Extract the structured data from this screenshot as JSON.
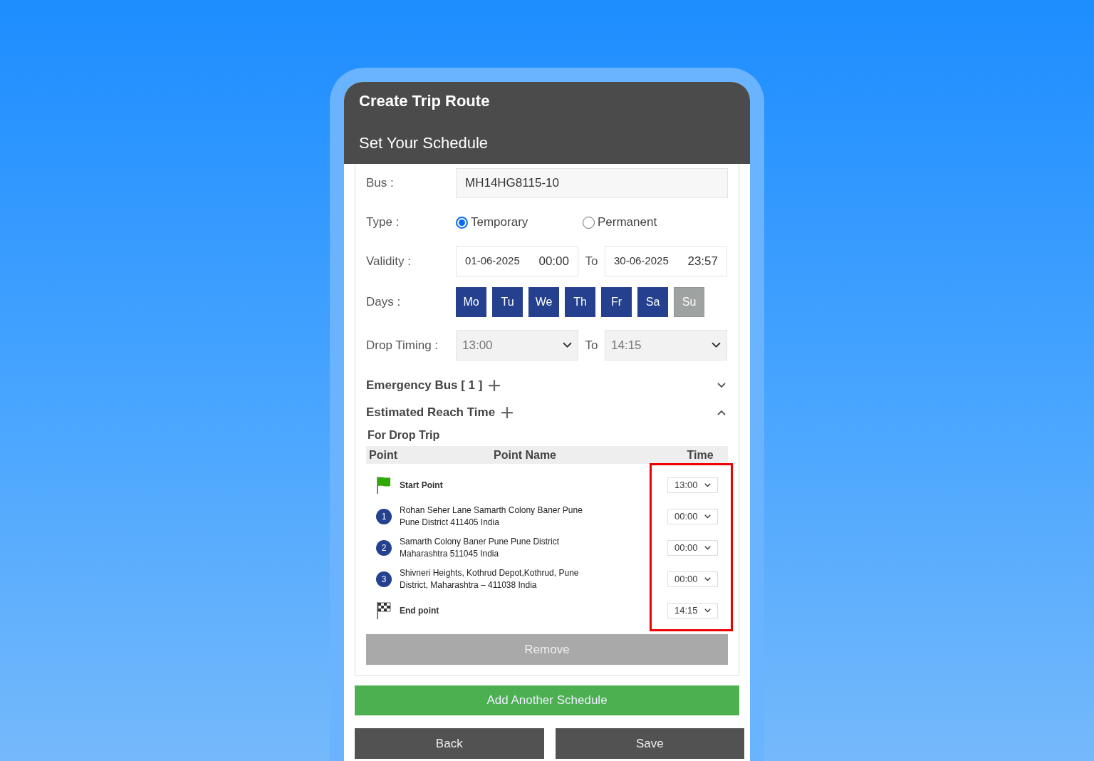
{
  "header": {
    "title": "Create Trip Route",
    "subtitle": "Set Your Schedule"
  },
  "form": {
    "bus": {
      "label": "Bus :",
      "value": "MH14HG8115-10"
    },
    "type": {
      "label": "Type :",
      "options": [
        {
          "label": "Temporary",
          "selected": true
        },
        {
          "label": "Permanent",
          "selected": false
        }
      ]
    },
    "validity": {
      "label": "Validity :",
      "from_date": "01-06-2025",
      "from_time": "00:00",
      "to_label": "To",
      "to_date": "30-06-2025",
      "to_time": "23:57"
    },
    "days": {
      "label": "Days :",
      "items": [
        {
          "label": "Mo",
          "selected": true
        },
        {
          "label": "Tu",
          "selected": true
        },
        {
          "label": "We",
          "selected": true
        },
        {
          "label": "Th",
          "selected": true
        },
        {
          "label": "Fr",
          "selected": true
        },
        {
          "label": "Sa",
          "selected": true
        },
        {
          "label": "Su",
          "selected": false
        }
      ]
    },
    "drop_timing": {
      "label": "Drop Timing :",
      "from": "13:00",
      "to_label": "To",
      "to": "14:15"
    }
  },
  "sections": [
    {
      "title": "Emergency Bus [ 1 ]",
      "expanded": false
    },
    {
      "title": "Estimated Reach Time",
      "expanded": true
    }
  ],
  "reach_table": {
    "title": "For Drop Trip",
    "columns": [
      "Point",
      "Point Name",
      "Time"
    ],
    "rows": [
      {
        "kind": "start",
        "name": "Start Point",
        "time": "13:00"
      },
      {
        "kind": "stop",
        "number": "1",
        "name": "Rohan Seher Lane Samarth Colony Baner Pune Pune District 411405 India",
        "time": "00:00"
      },
      {
        "kind": "stop",
        "number": "2",
        "name": "Samarth Colony Baner Pune Pune District Maharashtra 511045 India",
        "time": "00:00"
      },
      {
        "kind": "stop",
        "number": "3",
        "name": "Shivneri Heights, Kothrud Depot,Kothrud, Pune District, Maharashtra – 411038 India",
        "time": "00:00"
      },
      {
        "kind": "end",
        "name": "End point",
        "time": "14:15"
      }
    ]
  },
  "buttons": {
    "remove": "Remove",
    "add": "Add Another Schedule",
    "back": "Back",
    "save": "Save"
  }
}
